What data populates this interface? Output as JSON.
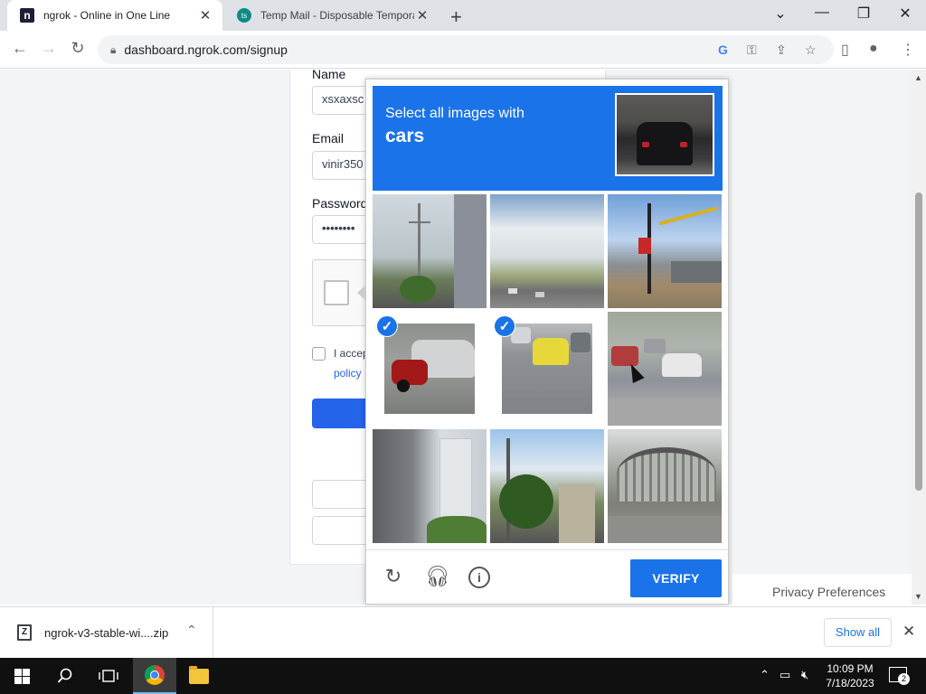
{
  "browser": {
    "tabs": [
      {
        "title": "ngrok - Online in One Line",
        "favicon": "n",
        "close": "✕"
      },
      {
        "title": "Temp Mail - Disposable Tempora",
        "favicon": "ts",
        "close": "✕"
      }
    ],
    "new_tab": "+",
    "window_controls": {
      "dropdown": "⌄",
      "minimize": "—",
      "restore": "❐",
      "close": "✕"
    },
    "url": "dashboard.ngrok.com/signup"
  },
  "form": {
    "name_label": "Name",
    "name_value": "xsxaxsc",
    "email_label": "Email",
    "email_value": "vinir350",
    "password_label": "Password",
    "password_value": "••••••••",
    "terms_text": "I accep",
    "policy_link": "policy"
  },
  "privacy_preferences": "Privacy Preferences",
  "captcha": {
    "instruction_line1": "Select all images with",
    "instruction_target": "cars",
    "verify_label": "VERIFY",
    "check_mark": "✓",
    "tiles": [
      {
        "scene": "power-lines",
        "selected": false
      },
      {
        "scene": "highway-clouds",
        "selected": false
      },
      {
        "scene": "railway-crossing",
        "selected": false
      },
      {
        "scene": "motorbike-and-car",
        "selected": true
      },
      {
        "scene": "taxi-traffic",
        "selected": true
      },
      {
        "scene": "busy-traffic",
        "selected": false
      },
      {
        "scene": "overpass-tower",
        "selected": false
      },
      {
        "scene": "city-street",
        "selected": false
      },
      {
        "scene": "covered-bridge",
        "selected": false
      }
    ],
    "icons": {
      "reload": "reload-icon",
      "audio": "headphones-icon",
      "info": "info-icon"
    }
  },
  "downloads": {
    "file_name": "ngrok-v3-stable-wi....zip",
    "show_all": "Show all"
  },
  "taskbar": {
    "time": "10:09 PM",
    "date": "7/18/2023",
    "notification_count": "2"
  },
  "colors": {
    "accent": "#1a73e8",
    "ngrok_brand": "#2563eb"
  }
}
